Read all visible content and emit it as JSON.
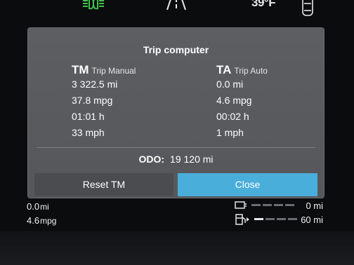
{
  "topbar": {
    "temperature": "39°F",
    "icons": [
      "headlights-icon",
      "lane-assist-icon",
      "car-icon"
    ]
  },
  "dialog": {
    "title": "Trip computer",
    "left": {
      "abbr": "TM",
      "name": "Trip Manual",
      "values": [
        "3 322.5 mi",
        "37.8 mpg",
        "01:01 h",
        "33 mph"
      ]
    },
    "right": {
      "abbr": "TA",
      "name": "Trip Auto",
      "values": [
        "0.0 mi",
        "4.6 mpg",
        "00:02 h",
        "1 mph"
      ]
    },
    "odo_label": "ODO:",
    "odo_value": "19 120 mi",
    "reset_label": "Reset TM",
    "close_label": "Close"
  },
  "bottom": {
    "left_distance": "0.0",
    "left_distance_unit": "mi",
    "left_consumption": "4.6",
    "left_consumption_unit": "mpg",
    "gauge1_value": "0 mi",
    "gauge2_value": "60 mi",
    "gauge1_level": 0,
    "gauge2_level": 0.25
  },
  "colors": {
    "accent": "#4aaedb",
    "indicator_green": "#3fc34a"
  }
}
